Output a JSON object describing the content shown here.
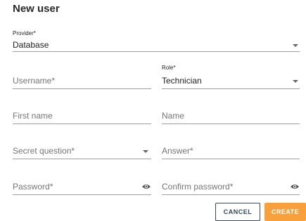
{
  "dialog": {
    "title": "New user",
    "provider": {
      "label": "Provider*",
      "value": "Database"
    },
    "username": {
      "placeholder": "Username*"
    },
    "role": {
      "label": "Role*",
      "value": "Technician"
    },
    "first_name": {
      "placeholder": "First name"
    },
    "name": {
      "placeholder": "Name"
    },
    "secret_question": {
      "placeholder": "Secret question*"
    },
    "answer": {
      "placeholder": "Answer*"
    },
    "password": {
      "placeholder": "Password*"
    },
    "confirm_password": {
      "placeholder": "Confirm password*"
    },
    "buttons": {
      "cancel": "CANCEL",
      "create": "CREATE"
    }
  },
  "colors": {
    "accent": "#f7a03c",
    "outline": "#37475a"
  },
  "icons": {
    "dropdown": "chevron-down-icon",
    "visibility": "eye-icon"
  }
}
